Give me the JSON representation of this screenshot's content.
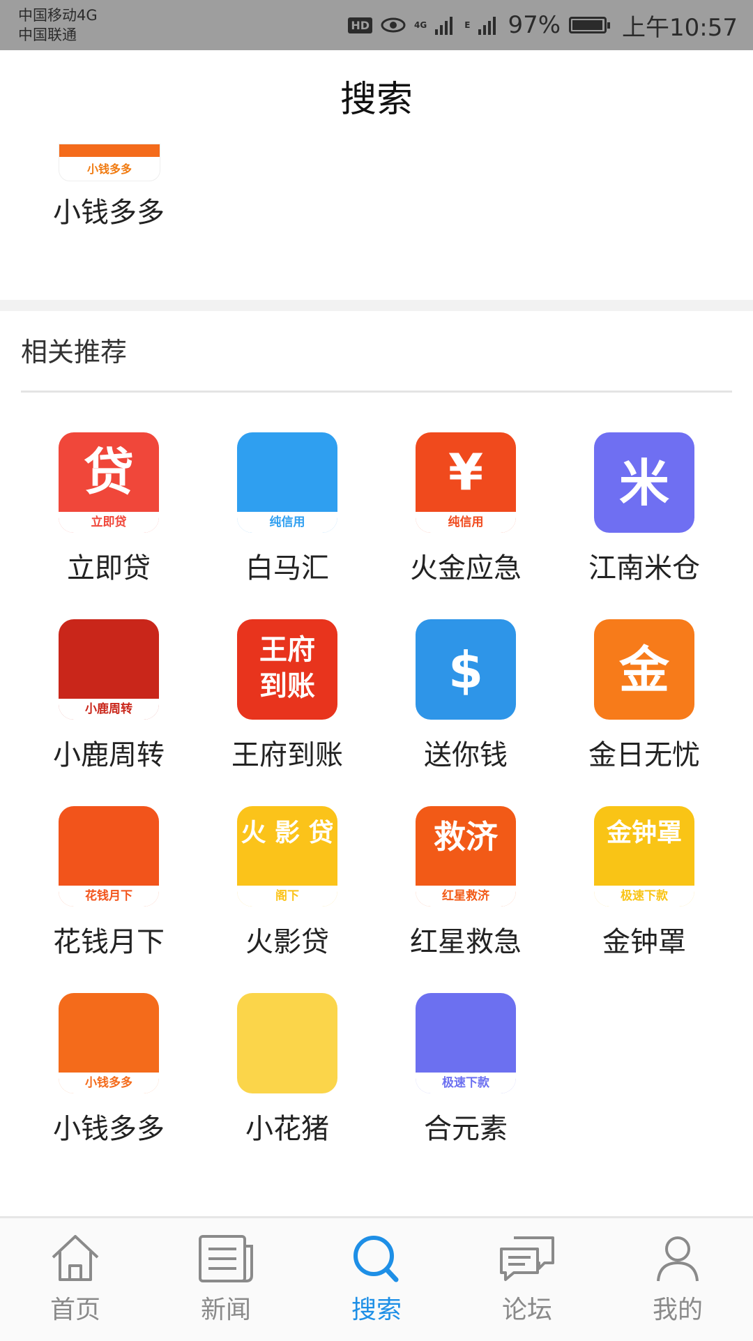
{
  "status_bar": {
    "carrier_1": "中国移动4G",
    "carrier_2": "中国联通",
    "hd": "HD",
    "net_a": "4G",
    "net_b": "E",
    "battery": "97%",
    "battery_level": 0.97,
    "time": "上午10:57"
  },
  "header": {
    "title": "搜索"
  },
  "top_item": {
    "icon_text": "小钱多多",
    "label": "小钱多多"
  },
  "section": {
    "title": "相关推荐"
  },
  "apps": [
    {
      "name": "立即贷",
      "icon_text": "贷",
      "icon_sub": "立即贷",
      "color": "#f0473a"
    },
    {
      "name": "白马汇",
      "icon_text": "",
      "icon_sub": "纯信用",
      "color": "#2f9ff0"
    },
    {
      "name": "火金应急",
      "icon_text": "¥",
      "icon_sub": "纯信用",
      "color": "#f04a1d"
    },
    {
      "name": "江南米仓",
      "icon_text": "米",
      "icon_sub": "",
      "color": "#6f6ff2"
    },
    {
      "name": "小鹿周转",
      "icon_text": "",
      "icon_sub": "小鹿周转",
      "color": "#c9261a"
    },
    {
      "name": "王府到账",
      "icon_text": "王府到账",
      "icon_sub": "",
      "color": "#e8341d"
    },
    {
      "name": "送你钱",
      "icon_text": "$",
      "icon_sub": "",
      "color": "#2e95e8"
    },
    {
      "name": "金日无忧",
      "icon_text": "金",
      "icon_sub": "",
      "color": "#f77b1a"
    },
    {
      "name": "花钱月下",
      "icon_text": "",
      "icon_sub": "花钱月下",
      "color": "#f2541b"
    },
    {
      "name": "火影贷",
      "icon_text": "火 影 贷",
      "icon_sub": "阁下",
      "color": "#fbc31a"
    },
    {
      "name": "红星救急",
      "icon_text": "救济",
      "icon_sub": "红星救济",
      "color": "#f25a17"
    },
    {
      "name": "金钟罩",
      "icon_text": "金钟罩",
      "icon_sub": "极速下款",
      "color": "#f9c416"
    },
    {
      "name": "小钱多多",
      "icon_text": "",
      "icon_sub": "小钱多多",
      "color": "#f46b1b"
    },
    {
      "name": "小花猪",
      "icon_text": "",
      "icon_sub": "",
      "color": "#fbd54a"
    },
    {
      "name": "合元素",
      "icon_text": "",
      "icon_sub": "极速下款",
      "color": "#6c70f0"
    }
  ],
  "nav": [
    {
      "label": "首页",
      "icon": "home-icon"
    },
    {
      "label": "新闻",
      "icon": "news-icon"
    },
    {
      "label": "搜索",
      "icon": "search-icon",
      "active": true
    },
    {
      "label": "论坛",
      "icon": "forum-icon"
    },
    {
      "label": "我的",
      "icon": "user-icon"
    }
  ],
  "colors": {
    "accent": "#1e8fe6",
    "status_bar": "#9e9e9e",
    "inactive": "#8a8a8a"
  }
}
